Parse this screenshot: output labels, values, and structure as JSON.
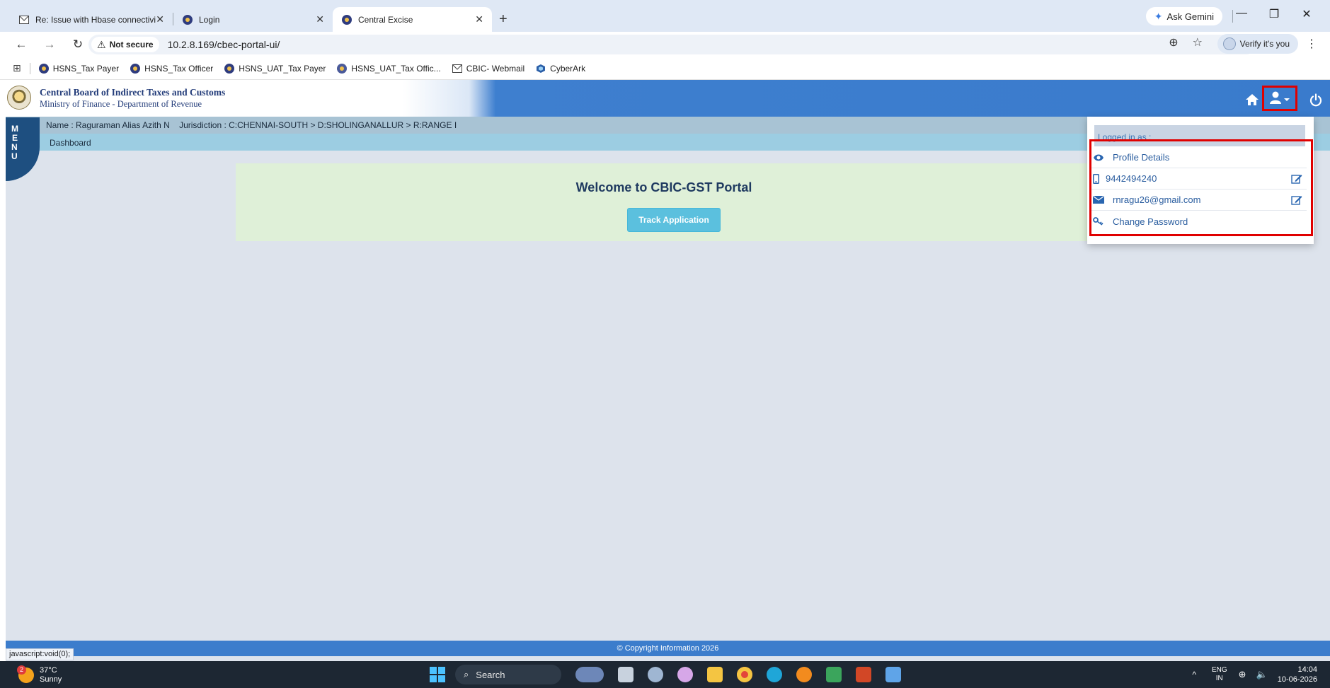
{
  "browser": {
    "tabs": [
      {
        "title": "Re: Issue with Hbase connectivi",
        "icon": "mail-icon"
      },
      {
        "title": "Login",
        "icon": "emblem-icon"
      },
      {
        "title": "Central Excise",
        "icon": "emblem-icon",
        "active": true
      }
    ],
    "new_tab": "+",
    "ask_gemini": "Ask Gemini",
    "security_label": "Not secure",
    "url": "10.2.8.169/cbec-portal-ui/",
    "verify_label": "Verify it's you",
    "bookmarks": [
      "HSNS_Tax Payer",
      "HSNS_Tax Officer",
      "HSNS_UAT_Tax Payer",
      "HSNS_UAT_Tax Offic...",
      "CBIC- Webmail",
      "CyberArk"
    ]
  },
  "portal": {
    "org_name": "Central Board of Indirect Taxes and Customs",
    "org_sub": "Ministry of Finance - Department of Revenue",
    "user_line": "Name : Raguraman Alias Azith N",
    "jurisdiction_line": "Jurisdiction : C:CHENNAI-SOUTH > D:SHOLINGANALLUR > R:RANGE I",
    "breadcrumb": "Dashboard",
    "menu_letters": [
      "M",
      "E",
      "N",
      "U"
    ],
    "welcome_title": "Welcome to CBIC-GST Portal",
    "track_button": "Track Application",
    "footer": "© Copyright Information 2026",
    "status_link": "javascript:void(0);",
    "accent_color": "#3a7bcc",
    "highlight_color": "#e00000"
  },
  "user_menu": {
    "logged_in_label": "Logged in as :",
    "items": [
      {
        "label": "Profile Details",
        "icon": "eye-icon"
      },
      {
        "label": "9442494240",
        "icon": "mobile-icon",
        "editable": true
      },
      {
        "label": "rnragu26@gmail.com",
        "icon": "envelope-icon",
        "editable": true
      },
      {
        "label": "Change Password",
        "icon": "key-icon"
      }
    ]
  },
  "taskbar": {
    "weather_badge": "2",
    "temperature": "37°C",
    "condition": "Sunny",
    "search_label": "Search",
    "lang_top": "ENG",
    "lang_bottom": "IN",
    "time": "14:04",
    "date": "10-06-2026"
  }
}
